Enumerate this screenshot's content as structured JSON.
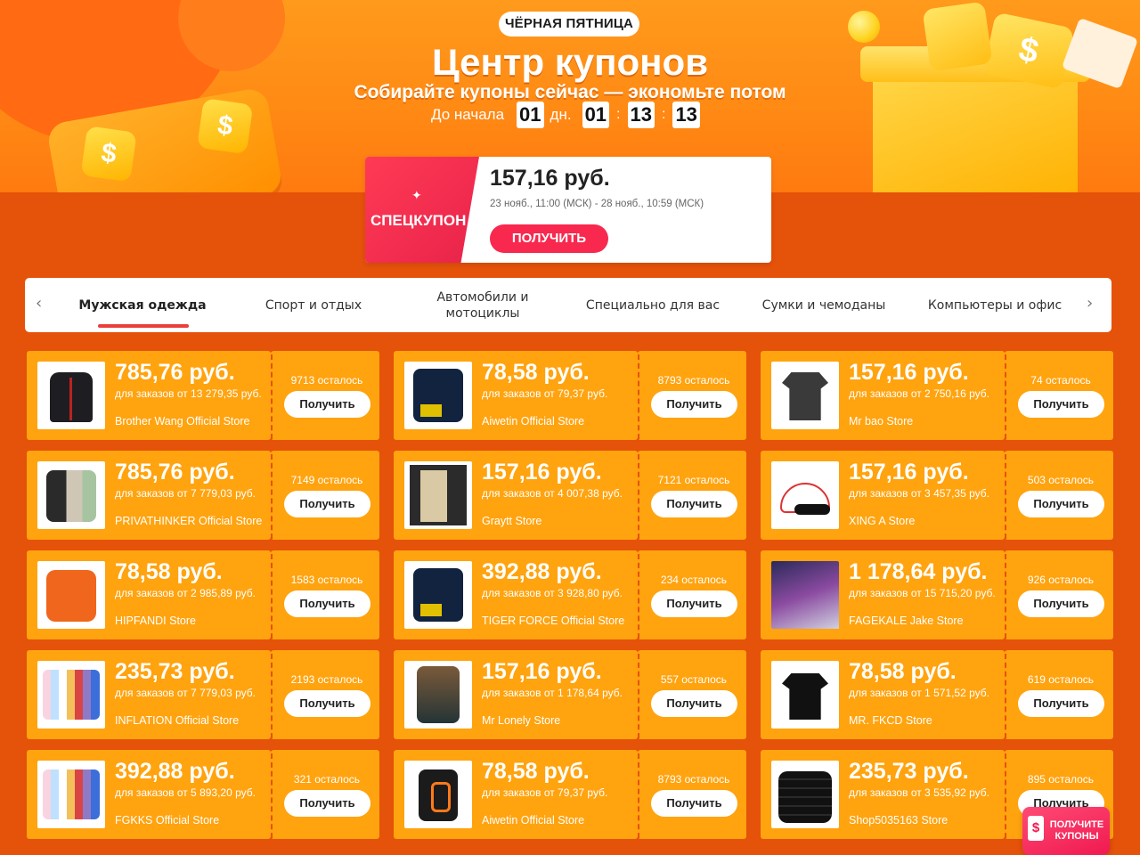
{
  "hero": {
    "badge": "ЧЁРНАЯ ПЯТНИЦА",
    "title": "Центр купонов",
    "subtitle": "Собирайте купоны сейчас — экономьте потом",
    "countdown": {
      "label": "До начала",
      "days": "01",
      "days_unit": "дн.",
      "hours": "01",
      "minutes": "13",
      "seconds": "13"
    },
    "decor_symbol": "$"
  },
  "special_coupon": {
    "label": "СПЕЦКУПОН",
    "amount": "157,16 руб.",
    "dates": "23 нояб., 11:00 (МСК) - 28 нояб., 10:59 (МСК)",
    "button": "ПОЛУЧИТЬ"
  },
  "tabs": {
    "items": [
      "Мужская одежда",
      "Спорт и отдых",
      "Автомобили и мотоциклы",
      "Специально для вас",
      "Сумки и чемоданы",
      "Компьютеры и офис"
    ],
    "active_index": 0,
    "prev_icon": "chevron-left-icon",
    "next_icon": "chevron-right-icon"
  },
  "coupons": [
    {
      "price": "785,76 руб.",
      "condition": "для заказов от 13 279,35 руб.",
      "store": "Brother Wang Official Store",
      "remaining": "9713 осталось",
      "button": "Получить",
      "image": "jacket"
    },
    {
      "price": "78,58 руб.",
      "condition": "для заказов от 79,37 руб.",
      "store": "Aiwetin Official Store",
      "remaining": "8793 осталось",
      "button": "Получить",
      "image": "blackjacket"
    },
    {
      "price": "157,16 руб.",
      "condition": "для заказов от 2 750,16 руб.",
      "store": "Mr bao Store",
      "remaining": "74 осталось",
      "button": "Получить",
      "image": "tshirt"
    },
    {
      "price": "785,76 руб.",
      "condition": "для заказов от 7 779,03 руб.",
      "store": "PRIVATHINKER Official Store",
      "remaining": "7149 осталось",
      "button": "Получить",
      "image": "hood"
    },
    {
      "price": "157,16 руб.",
      "condition": "для заказов от 4 007,38 руб.",
      "store": "Graytt Store",
      "remaining": "7121 осталось",
      "button": "Получить",
      "image": "pants"
    },
    {
      "price": "157,16 руб.",
      "condition": "для заказов от 3 457,35 руб.",
      "store": "XING A Store",
      "remaining": "503 осталось",
      "button": "Получить",
      "image": "cap"
    },
    {
      "price": "78,58 руб.",
      "condition": "для заказов от 2 985,89 руб.",
      "store": "HIPFANDI Store",
      "remaining": "1583 осталось",
      "button": "Получить",
      "image": "orange"
    },
    {
      "price": "392,88 руб.",
      "condition": "для заказов от 3 928,80 руб.",
      "store": "TIGER FORCE Official Store",
      "remaining": "234 осталось",
      "button": "Получить",
      "image": "blackjacket"
    },
    {
      "price": "1 178,64 руб.",
      "condition": "для заказов от 15 715,20 руб.",
      "store": "FAGEKALE Jake Store",
      "remaining": "926 осталось",
      "button": "Получить",
      "image": "photo"
    },
    {
      "price": "235,73 руб.",
      "condition": "для заказов от 7 779,03 руб.",
      "store": "INFLATION Official Store",
      "remaining": "2193 осталось",
      "button": "Получить",
      "image": "multi"
    },
    {
      "price": "157,16 руб.",
      "condition": "для заказов от 1 178,64 руб.",
      "store": "Mr Lonely Store",
      "remaining": "557 осталось",
      "button": "Получить",
      "image": "skull"
    },
    {
      "price": "78,58 руб.",
      "condition": "для заказов от 1 571,52 руб.",
      "store": "MR. FKCD Store",
      "remaining": "619 осталось",
      "button": "Получить",
      "image": "blktee"
    },
    {
      "price": "392,88 руб.",
      "condition": "для заказов от 5 893,20 руб.",
      "store": "FGKKS Official Store",
      "remaining": "321 осталось",
      "button": "Получить",
      "image": "multi"
    },
    {
      "price": "78,58 руб.",
      "condition": "для заказов от 79,37 руб.",
      "store": "Aiwetin Official Store",
      "remaining": "8793 осталось",
      "button": "Получить",
      "image": "vest"
    },
    {
      "price": "235,73 руб.",
      "condition": "для заказов от 3 535,92 руб.",
      "store": "Shop5035163 Store",
      "remaining": "895 осталось",
      "button": "Получить",
      "image": "puffer"
    }
  ],
  "promo": {
    "text": "ПОЛУЧИТЕ КУПОНЫ",
    "icon_symbol": "$"
  },
  "colors": {
    "page_bg": "#e5520a",
    "coupon_bg": "#ffa30f",
    "accent_red": "#f8284e",
    "tab_underline": "#ea3f3a"
  }
}
